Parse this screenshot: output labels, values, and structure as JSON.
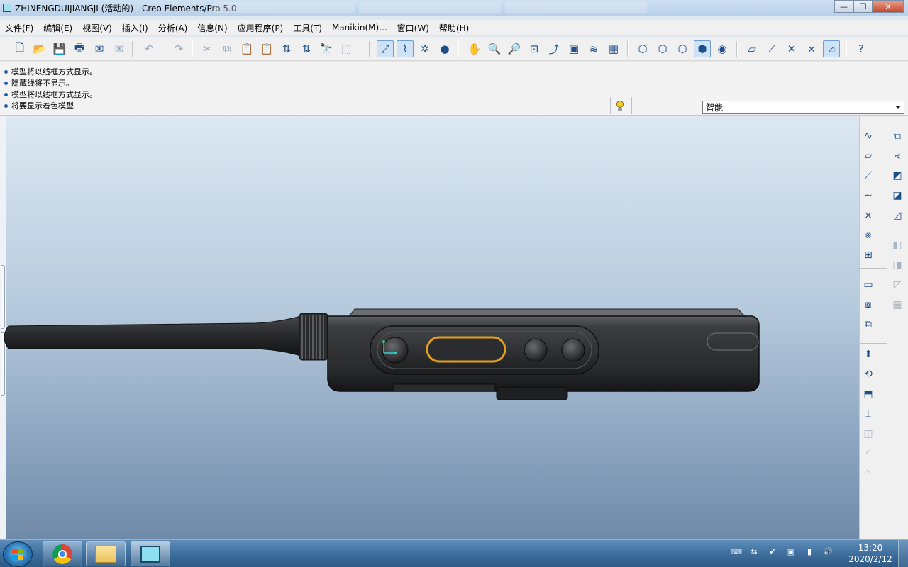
{
  "window": {
    "title": "ZHINENGDUIJIANGJI (活动的) - Creo Elements/Pro 5.0",
    "minimize_glyph": "—",
    "maximize_glyph": "❐",
    "close_glyph": "✕"
  },
  "menu": {
    "items": [
      {
        "label": "文件(F)"
      },
      {
        "label": "编辑(E)"
      },
      {
        "label": "视图(V)"
      },
      {
        "label": "插入(I)"
      },
      {
        "label": "分析(A)"
      },
      {
        "label": "信息(N)"
      },
      {
        "label": "应用程序(P)"
      },
      {
        "label": "工具(T)"
      },
      {
        "label": "Manikin(M)..."
      },
      {
        "label": "窗口(W)"
      },
      {
        "label": "帮助(H)"
      }
    ]
  },
  "messages": [
    "模型将以线框方式显示。",
    "隐藏线将不显示。",
    "模型将以线框方式显示。",
    "将要显示着色模型"
  ],
  "filter": {
    "selected": "智能"
  },
  "toolbar_icons": [
    {
      "name": "new-icon",
      "glyph": "🗋",
      "state": "normal"
    },
    {
      "name": "open-icon",
      "glyph": "📂",
      "state": "normal"
    },
    {
      "name": "save-icon",
      "glyph": "💾",
      "state": "normal"
    },
    {
      "name": "print-icon",
      "glyph": "🖶",
      "state": "normal"
    },
    {
      "name": "send-mail-icon",
      "glyph": "✉",
      "state": "normal"
    },
    {
      "name": "send-mail-attachment-icon",
      "glyph": "✉",
      "state": "dim"
    },
    {
      "name": "undo-icon",
      "glyph": "↶",
      "state": "dim"
    },
    {
      "name": "redo-icon",
      "glyph": "↷",
      "state": "dim"
    },
    {
      "name": "cut-icon",
      "glyph": "✂",
      "state": "dim"
    },
    {
      "name": "copy-icon",
      "glyph": "⧉",
      "state": "dim"
    },
    {
      "name": "paste-icon",
      "glyph": "📋",
      "state": "dim"
    },
    {
      "name": "paste-special-icon",
      "glyph": "📋",
      "state": "dim"
    },
    {
      "name": "regenerate-icon",
      "glyph": "⇅",
      "state": "normal"
    },
    {
      "name": "regenerate-manager-icon",
      "glyph": "⇅",
      "state": "normal"
    },
    {
      "name": "find-icon",
      "glyph": "🔭",
      "state": "normal"
    },
    {
      "name": "selection-box-icon",
      "glyph": "⬚",
      "state": "dim"
    },
    {
      "name": "refit-icon",
      "glyph": "⤢",
      "state": "active"
    },
    {
      "name": "datum-display-icon",
      "glyph": "⌇",
      "state": "active"
    },
    {
      "name": "spin-center-icon",
      "glyph": "✲",
      "state": "normal"
    },
    {
      "name": "appearance-ball-icon",
      "glyph": "●",
      "state": "normal"
    },
    {
      "name": "pan-hand-icon",
      "glyph": "✋",
      "state": "normal"
    },
    {
      "name": "zoom-in-icon",
      "glyph": "🔍",
      "state": "normal"
    },
    {
      "name": "zoom-out-icon",
      "glyph": "🔎",
      "state": "normal"
    },
    {
      "name": "zoom-fit-icon",
      "glyph": "⊡",
      "state": "normal"
    },
    {
      "name": "reorient-icon",
      "glyph": "⤴",
      "state": "normal"
    },
    {
      "name": "saved-views-icon",
      "glyph": "▣",
      "state": "normal"
    },
    {
      "name": "layers-icon",
      "glyph": "≋",
      "state": "normal"
    },
    {
      "name": "view-manager-icon",
      "glyph": "▦",
      "state": "normal"
    },
    {
      "name": "wireframe-icon",
      "glyph": "⬡",
      "state": "normal"
    },
    {
      "name": "hidden-line-icon",
      "glyph": "⬡",
      "state": "normal"
    },
    {
      "name": "no-hidden-icon",
      "glyph": "⬡",
      "state": "normal"
    },
    {
      "name": "shading-icon",
      "glyph": "⬢",
      "state": "active"
    },
    {
      "name": "enhanced-realism-icon",
      "glyph": "◉",
      "state": "normal"
    },
    {
      "name": "plane-display-icon",
      "glyph": "▱",
      "state": "normal"
    },
    {
      "name": "axis-display-icon",
      "glyph": "⟋",
      "state": "normal"
    },
    {
      "name": "point-display-icon",
      "glyph": "✕",
      "state": "normal"
    },
    {
      "name": "csys-display-icon",
      "glyph": "⨯",
      "state": "normal"
    },
    {
      "name": "annotation-display-icon",
      "glyph": "⊿",
      "state": "active"
    },
    {
      "name": "context-help-icon",
      "glyph": "?",
      "state": "normal"
    }
  ],
  "right_icons_col1": [
    {
      "name": "sketch-curve-icon",
      "glyph": "∿",
      "state": "normal"
    },
    {
      "name": "datum-plane-icon",
      "glyph": "▱",
      "state": "normal"
    },
    {
      "name": "datum-axis-icon",
      "glyph": "⟋",
      "state": "normal"
    },
    {
      "name": "datum-curve-icon",
      "glyph": "∼",
      "state": "normal"
    },
    {
      "name": "datum-point-icon",
      "glyph": "⨯",
      "state": "normal"
    },
    {
      "name": "datum-csys-icon",
      "glyph": "⨳",
      "state": "normal"
    },
    {
      "name": "analysis-feature-icon",
      "glyph": "⊞",
      "state": "normal"
    },
    {
      "name": "sketch-tool-icon",
      "glyph": "▭",
      "state": "normal"
    },
    {
      "name": "sketch-view-icon",
      "glyph": "⧇",
      "state": "normal"
    },
    {
      "name": "copy-geometry-icon",
      "glyph": "⧉",
      "state": "normal"
    },
    {
      "name": "extrude-icon",
      "glyph": "⬆",
      "state": "normal"
    },
    {
      "name": "revolve-icon",
      "glyph": "⟲",
      "state": "normal"
    },
    {
      "name": "sweep-icon",
      "glyph": "⬒",
      "state": "normal"
    },
    {
      "name": "blend-icon",
      "glyph": "⌶",
      "state": "normal"
    },
    {
      "name": "hole-icon",
      "glyph": "◫",
      "state": "dim"
    },
    {
      "name": "round-icon",
      "glyph": "◜",
      "state": "dim"
    },
    {
      "name": "chamfer-icon",
      "glyph": "◝",
      "state": "dim"
    }
  ],
  "right_icons_col2": [
    {
      "name": "copy-icon",
      "glyph": "⧉",
      "state": "normal"
    },
    {
      "name": "mirror-icon",
      "glyph": "⫷",
      "state": "normal"
    },
    {
      "name": "offset-surface-icon",
      "glyph": "◩",
      "state": "normal"
    },
    {
      "name": "extend-surface-icon",
      "glyph": "◪",
      "state": "normal"
    },
    {
      "name": "boundary-blend-icon",
      "glyph": "◿",
      "state": "normal"
    },
    {
      "name": "merge-icon",
      "glyph": "◧",
      "state": "dim"
    },
    {
      "name": "trim-icon",
      "glyph": "◨",
      "state": "dim"
    },
    {
      "name": "thicken-icon",
      "glyph": "◸",
      "state": "dim"
    },
    {
      "name": "solidify-icon",
      "glyph": "▦",
      "state": "dim"
    }
  ],
  "taskbar": {
    "time": "13:20",
    "date": "2020/2/12",
    "tray_glyphs": [
      "⌨",
      "⇆",
      "✔",
      "▣",
      "▮",
      "🔊"
    ]
  }
}
